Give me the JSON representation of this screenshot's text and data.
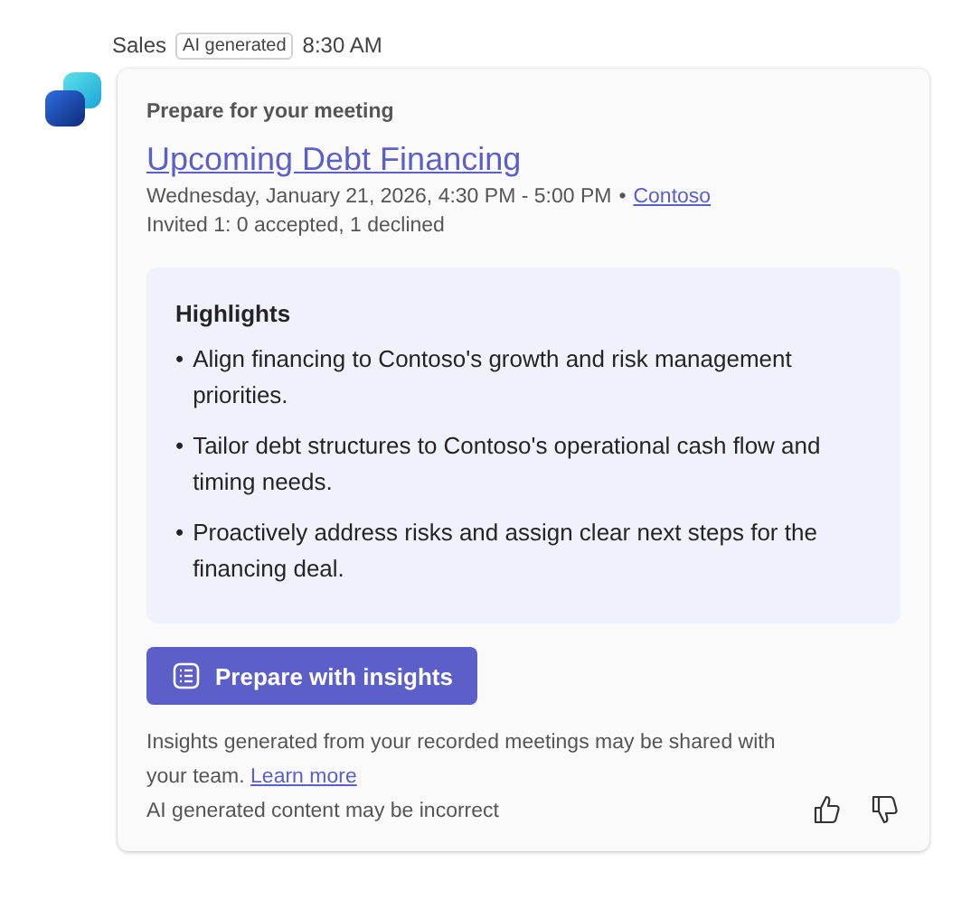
{
  "message": {
    "sender": "Sales",
    "badge": "AI generated",
    "time": "8:30 AM"
  },
  "card": {
    "heading": "Prepare for your meeting",
    "meeting_title": "Upcoming Debt Financing",
    "when": "Wednesday, January 21, 2026, 4:30 PM - 5:00 PM",
    "separator": "•",
    "organization": "Contoso",
    "invites": "Invited 1: 0 accepted, 1 declined",
    "highlights": {
      "title": "Highlights",
      "items": [
        {
          "bullet": "•",
          "text": "Align financing to Contoso's growth and risk management priorities."
        },
        {
          "bullet": "•",
          "text": "Tailor debt structures to Contoso's operational cash flow and timing needs."
        },
        {
          "bullet": "•",
          "text": "Proactively address risks and assign clear next steps for the financing deal."
        }
      ]
    },
    "button": "Prepare with insights",
    "notice": "Insights generated from your recorded meetings may be shared with your team.",
    "learn_more": "Learn more",
    "disclaimer": "AI generated content may be incorrect"
  }
}
